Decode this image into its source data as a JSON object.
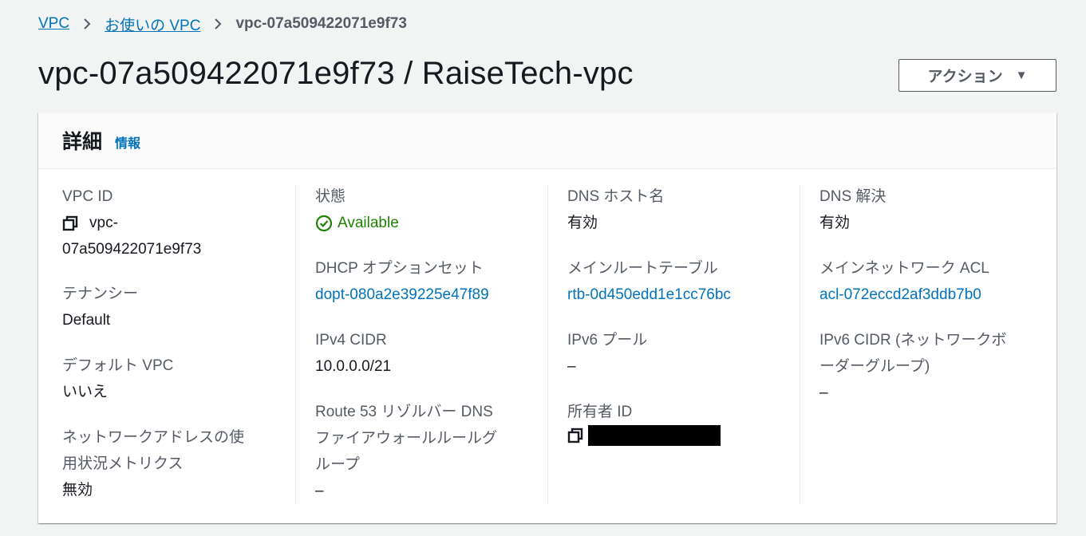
{
  "breadcrumb": {
    "items": [
      "VPC",
      "お使いの VPC"
    ],
    "current": "vpc-07a509422071e9f73"
  },
  "page": {
    "title": "vpc-07a509422071e9f73 / RaiseTech-vpc",
    "action_label": "アクション"
  },
  "panel": {
    "title": "詳細",
    "info_label": "情報"
  },
  "details": {
    "vpc_id": {
      "label": "VPC ID",
      "value_line1": "vpc-",
      "value_line2": "07a509422071e9f73"
    },
    "tenancy": {
      "label": "テナンシー",
      "value": "Default"
    },
    "default_vpc": {
      "label": "デフォルト VPC",
      "value": "いいえ"
    },
    "network_address_usage": {
      "label_line1": "ネットワークアドレスの使",
      "label_line2": "用状況メトリクス",
      "value": "無効"
    },
    "state": {
      "label": "状態",
      "value": "Available"
    },
    "dhcp": {
      "label": "DHCP オプションセット",
      "value": "dopt-080a2e39225e47f89"
    },
    "ipv4_cidr": {
      "label": "IPv4 CIDR",
      "value": "10.0.0.0/21"
    },
    "route53": {
      "label_line1": "Route 53 リゾルバー DNS",
      "label_line2": "ファイアウォールルールグ",
      "label_line3": "ループ",
      "value": "–"
    },
    "dns_hostnames": {
      "label": "DNS ホスト名",
      "value": "有効"
    },
    "main_route_table": {
      "label": "メインルートテーブル",
      "value": "rtb-0d450edd1e1cc76bc"
    },
    "ipv6_pool": {
      "label": "IPv6 プール",
      "value": "–"
    },
    "owner_id": {
      "label": "所有者 ID"
    },
    "dns_resolution": {
      "label": "DNS 解決",
      "value": "有効"
    },
    "main_network_acl": {
      "label": "メインネットワーク ACL",
      "value": "acl-072eccd2af3ddb7b0"
    },
    "ipv6_cidr": {
      "label_line1": "IPv6 CIDR (ネットワークボ",
      "label_line2": "ーダーグループ)",
      "value": "–"
    }
  },
  "colors": {
    "link": "#0073bb",
    "available": "#1d8102",
    "background": "#f2f3f3"
  },
  "icons": {
    "copy": "copy-icon",
    "status": "check-circle-icon",
    "separator": "chevron-right-icon",
    "action": "caret-down-icon"
  }
}
